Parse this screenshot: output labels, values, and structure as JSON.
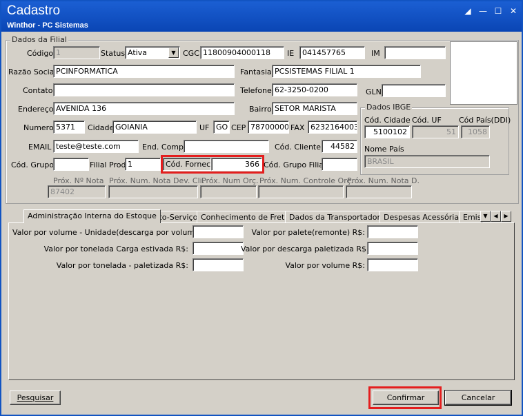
{
  "window": {
    "title": "Cadastro",
    "subtitle": "Winthor - PC Sistemas"
  },
  "filial": {
    "group_title": "Dados da Filial",
    "codigo_label": "Código",
    "codigo_value": "1",
    "status_label": "Status",
    "status_value": "Ativa",
    "cgc_label": "CGC",
    "cgc_value": "11800904000118",
    "ie_label": "IE",
    "ie_value": "041457765",
    "im_label": "IM",
    "im_value": "",
    "razao_label": "Razão Social",
    "razao_value": "PCINFORMATICA",
    "fantasia_label": "Fantasia",
    "fantasia_value": "PCSISTEMAS FILIAL 1",
    "contato_label": "Contato",
    "contato_value": "",
    "telefone_label": "Telefone",
    "telefone_value": "62-3250-0200",
    "gln_label": "GLN",
    "gln_value": "",
    "endereco_label": "Endereço",
    "endereco_value": "AVENIDA 136",
    "bairro_label": "Bairro",
    "bairro_value": "SETOR MARISTA",
    "numero_label": "Numero",
    "numero_value": "5371",
    "cidade_label": "Cidade",
    "cidade_value": "GOIANIA",
    "uf_label": "UF",
    "uf_value": "GO",
    "cep_label": "CEP",
    "cep_value": "78700000",
    "fax_label": "FAX",
    "fax_value": "6232164003",
    "email_label": "EMAIL",
    "email_value": "teste@teste.com",
    "endcomp_label": "End. Comp.",
    "endcomp_value": "",
    "codcliente_label": "Cód. Cliente",
    "codcliente_value": "44582",
    "codgrupo_label": "Cód. Grupo",
    "codgrupo_value": "",
    "filialprod_label": "Filial Prod.",
    "filialprod_value": "1",
    "codfornec_label": "Cód. Fornec.",
    "codfornec_value": "366",
    "codgrupofilial_label": "Cód. Grupo Filial",
    "codgrupofilial_value": "",
    "proxnota_label": "Próx. Nº Nota",
    "proxnota_value": "87402",
    "proxnotadev_label": "Próx. Num. Nota Dev. Cli.",
    "proxnotadev_value": "",
    "proxorc_label": "Próx. Num Orç.",
    "proxorc_value": "",
    "proxcontrole_label": "Próx. Num. Controle Orç.",
    "proxcontrole_value": "",
    "proxnotad_label": "Próx. Num. Nota D.",
    "proxnotad_value": ""
  },
  "ibge": {
    "group_title": "Dados IBGE",
    "codcidade_label": "Cód. Cidade",
    "codcidade_value": "5100102",
    "coduf_label": "Cód. UF",
    "coduf_value": "51",
    "codpais_label": "Cód País(DDI)",
    "codpais_value": "1058",
    "nomepais_label": "Nome País",
    "nomepais_value": "BRASIL"
  },
  "tabs": [
    {
      "label": "Administração Interna do Estoque"
    },
    {
      "label": "Auto-Serviço"
    },
    {
      "label": "Conhecimento de Frete"
    },
    {
      "label": "Dados da Transportadora"
    },
    {
      "label": "Despesas Acessórias"
    },
    {
      "label": "Emiss"
    }
  ],
  "estoque": {
    "volume_unidade_label": "Valor por volume - Unidade(descarga por volume)R$:",
    "tonelada_estivada_label": "Valor por tonelada Carga estivada R$:",
    "tonelada_paletizada_label": "Valor por tonelada - paletizada R$:",
    "palete_label": "Valor por palete(remonte) R$:",
    "descarga_paletizada_label": "Valor por descarga paletizada R$:",
    "volume_label": "Valor por volume R$:"
  },
  "buttons": {
    "pesquisar": "Pesquisar",
    "confirmar": "Confirmar",
    "cancelar": "Cancelar"
  }
}
